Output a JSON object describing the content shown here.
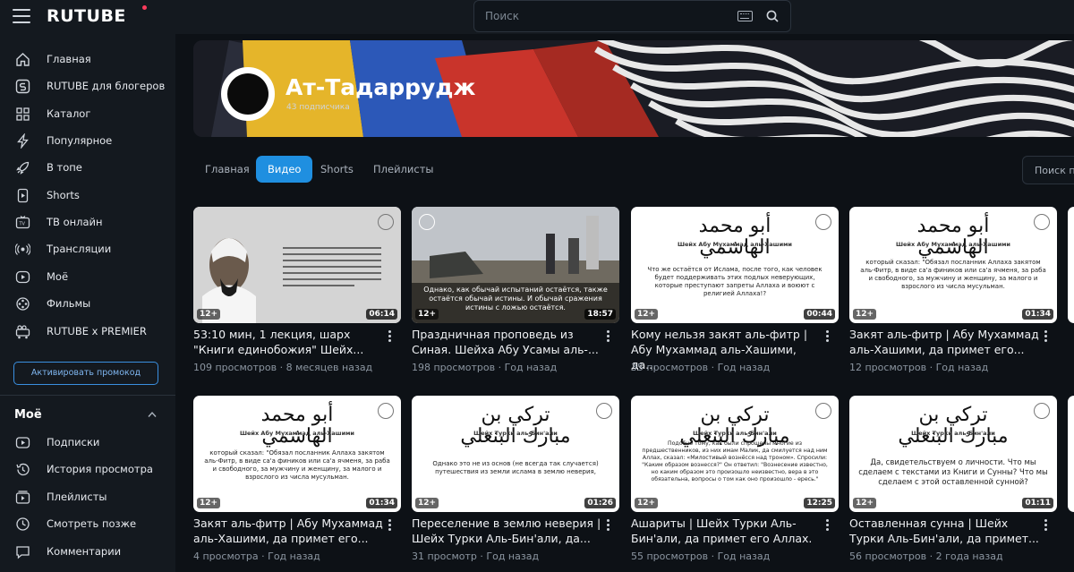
{
  "header": {
    "logo": "RUTUBE",
    "search_placeholder": "Поиск"
  },
  "sidebar": {
    "items": [
      {
        "label": "Главная",
        "icon": "home-icon"
      },
      {
        "label": "RUTUBE для блогеров",
        "icon": "rutube-s-icon"
      },
      {
        "label": "Каталог",
        "icon": "grid-icon"
      },
      {
        "label": "Популярное",
        "icon": "lightning-icon"
      },
      {
        "label": "В топе",
        "icon": "rocket-icon"
      },
      {
        "label": "Shorts",
        "icon": "shorts-icon"
      },
      {
        "label": "ТВ онлайн",
        "icon": "tv-icon"
      },
      {
        "label": "Трансляции",
        "icon": "broadcast-icon"
      },
      {
        "label": "Моё",
        "icon": "my-icon"
      },
      {
        "label": "Фильмы",
        "icon": "film-icon"
      },
      {
        "label": "RUTUBE x PREMIER",
        "icon": "premier-icon"
      }
    ],
    "promo_button": "Активировать промокод",
    "section_title": "Моё",
    "my_items": [
      {
        "label": "Подписки",
        "icon": "subscriptions-icon"
      },
      {
        "label": "История просмотра",
        "icon": "history-icon"
      },
      {
        "label": "Плейлисты",
        "icon": "playlist-icon"
      },
      {
        "label": "Смотреть позже",
        "icon": "clock-icon"
      },
      {
        "label": "Комментарии",
        "icon": "comment-icon"
      }
    ]
  },
  "channel": {
    "title": "Ат-Тадаррудж",
    "subscribers": "43 подписчика"
  },
  "tabs": [
    {
      "label": "Главная"
    },
    {
      "label": "Видео"
    },
    {
      "label": "Shorts"
    },
    {
      "label": "Плейлисты"
    }
  ],
  "channel_search_placeholder": "Поиск по",
  "videos": [
    {
      "title": "53:10 мин, 1 лекция, шарх \"Книги единобожия\" Шейх...",
      "views": "109 просмотров",
      "date": "8 месяцев назад",
      "age": "12+",
      "duration": "06:14"
    },
    {
      "title": "Праздничная проповедь из Синая. Шейха Абу Усамы аль-...",
      "views": "198 просмотров",
      "date": "Год назад",
      "age": "12+",
      "duration": "18:57",
      "thumb_text": "Однако, как обычай испытаний остаётся, также остаётся обычай истины. И обычай сражения истины с ложью остаётся."
    },
    {
      "title": "Кому нельзя закят аль-фитр | Абу Мухаммад аль-Хашими, да...",
      "views": "35 просмотров",
      "date": "Год назад",
      "age": "12+",
      "duration": "00:44",
      "thumb_arabic": "أبو محمد الهاشمي",
      "thumb_sub": "Шейх Абу Мухаммад аль-Хашими",
      "thumb_text": "Что же остаётся от Ислама, после того, как человек будет поддерживать этих подлых неверующих, которые преступают запреты Аллаха и воюют с религией Аллаха!?"
    },
    {
      "title": "Закят аль-фитр | Абу Мухаммад аль-Хашими, да примет его...",
      "views": "12 просмотров",
      "date": "Год назад",
      "age": "12+",
      "duration": "01:34",
      "thumb_arabic": "أبو محمد الهاشمي",
      "thumb_sub": "Шейх Абу Мухаммад аль-Хашими",
      "thumb_text": "который сказал: \"Обязал посланник Аллаха закятом аль-Фитр, в виде са'а фиников или са'а ячменя, за раба и свободного, за мужчину и женщину, за малого и взрослого из числа мусульман."
    },
    {
      "title": "Закят аль-фитр | Абу Мухаммад аль-Хашими, да примет его...",
      "views": "4 просмотра",
      "date": "Год назад",
      "age": "12+",
      "duration": "01:34",
      "thumb_arabic": "أبو محمد الهاشمي",
      "thumb_sub": "Шейх Абу Мухаммад аль-Хашими",
      "thumb_text": "который сказал: \"Обязал посланник Аллаха закятом аль-Фитр, в виде са'а фиников или са'а ячменя, за раба и свободного, за мужчину и женщину, за малого и взрослого из числа мусульман."
    },
    {
      "title": "Переселение в землю неверия | Шейх Турки Аль-Бин'али, да...",
      "views": "31 просмотр",
      "date": "Год назад",
      "age": "12+",
      "duration": "01:26",
      "thumb_arabic": "تركي بن مبارك البنعلي",
      "thumb_sub": "Шейх Турки аль-Бин'али",
      "thumb_text": "Однако это не из основ (не всегда так случается) путешествия из земли ислама в землю неверия,"
    },
    {
      "title": "Ашариты | Шейх Турки Аль-Бин'али, да примет его Аллах.",
      "views": "55 просмотров",
      "date": "Год назад",
      "age": "12+",
      "duration": "12:25",
      "thumb_arabic": "تركي بن مبارك البنعلي",
      "thumb_sub": "Шейх Турки аль-Бин'али",
      "thumb_text": "Подобно тому, как были спрошены многие из предшественников, из них имам Малик, да смилуется над ним Аллах, сказал: «Милостивый вознёсся над троном». Спросили: \"Каким образом вознесся?\" Он ответил: \"Вознесение известно, но каким образом это произошло неизвестно, вера в это обязательна, вопросы о том как оно произошло - ересь.\""
    },
    {
      "title": "Оставленная сунна | Шейх Турки Аль-Бин'али, да примет...",
      "views": "56 просмотров",
      "date": "2 года назад",
      "age": "12+",
      "duration": "01:11",
      "thumb_arabic": "تركي بن مبارك البنعلي",
      "thumb_sub": "Шейх Турки аль-Бин'али",
      "thumb_text": "Да, свидетельствуем о личности. Что мы сделаем с текстами из Книги и Сунны? Что мы сделаем с этой оставленной сунной?"
    }
  ],
  "colors": {
    "accent": "#1f8fe0",
    "background": "#0d1116",
    "sidebar": "#14191f"
  }
}
